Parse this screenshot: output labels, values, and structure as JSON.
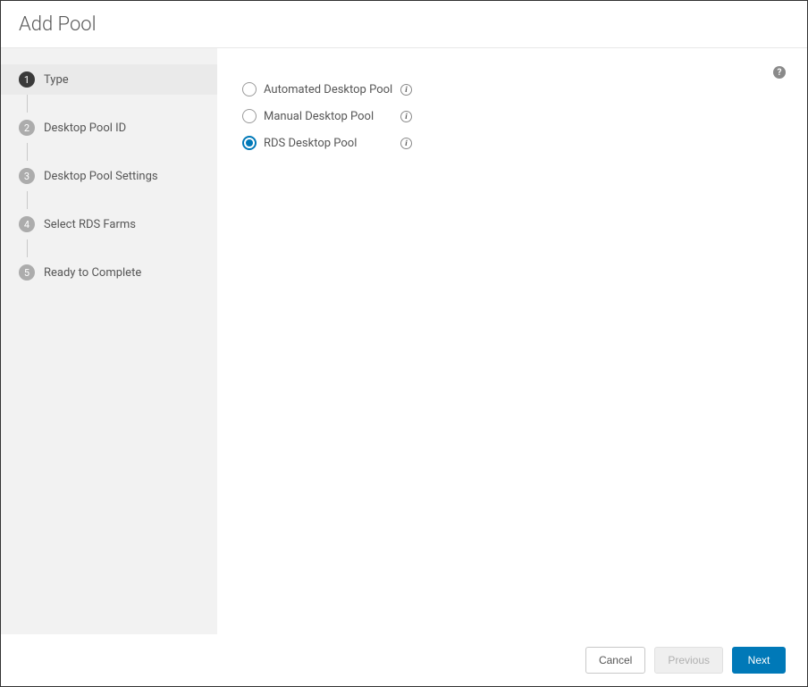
{
  "header": {
    "title": "Add Pool"
  },
  "sidebar": {
    "steps": [
      {
        "num": "1",
        "label": "Type",
        "active": true
      },
      {
        "num": "2",
        "label": "Desktop Pool ID",
        "active": false
      },
      {
        "num": "3",
        "label": "Desktop Pool Settings",
        "active": false
      },
      {
        "num": "4",
        "label": "Select RDS Farms",
        "active": false
      },
      {
        "num": "5",
        "label": "Ready to Complete",
        "active": false
      }
    ]
  },
  "content": {
    "options": [
      {
        "label": "Automated Desktop Pool",
        "selected": false
      },
      {
        "label": "Manual Desktop Pool",
        "selected": false
      },
      {
        "label": "RDS Desktop Pool",
        "selected": true
      }
    ]
  },
  "footer": {
    "cancel": "Cancel",
    "previous": "Previous",
    "next": "Next"
  },
  "icons": {
    "help": "?",
    "info": "i"
  }
}
